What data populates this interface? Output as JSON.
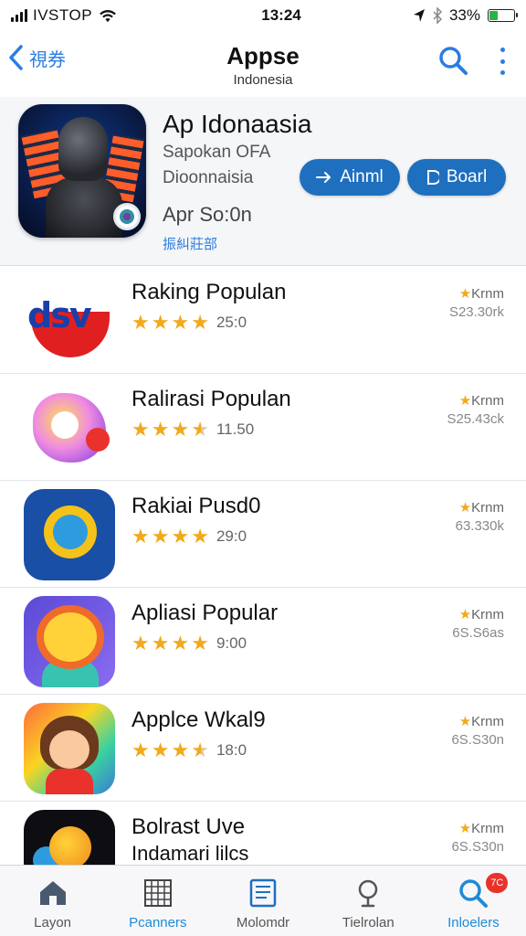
{
  "status_bar": {
    "carrier": "IVSTOP",
    "time": "13:24",
    "battery": "33%",
    "battery_level": 0.33
  },
  "nav": {
    "back_label": "視券",
    "title": "Appse",
    "subtitle": "Indonesia"
  },
  "featured": {
    "title": "Ap Idonaasia",
    "line1": "Sapokan OFA",
    "line2": "Dioonnaisia",
    "line3": "Apr So:0n",
    "line4": "振糾莊部",
    "install_label": "Ainml",
    "board_label": "Boarl"
  },
  "apps": [
    {
      "name": "Raking Populan",
      "name2": "",
      "rating": 4,
      "rating_text": "25:0",
      "meta_label": "Krnm",
      "meta_value": "S23.30rk"
    },
    {
      "name": "Ralirasi Populan",
      "name2": "",
      "rating": 3.5,
      "rating_text": "11.50",
      "meta_label": "Krnm",
      "meta_value": "S25.43ck"
    },
    {
      "name": "Rakiai Pusd0",
      "name2": "",
      "rating": 4,
      "rating_text": "29:0",
      "meta_label": "Krnm",
      "meta_value": "63.330k"
    },
    {
      "name": "Apliasi Popular",
      "name2": "",
      "rating": 4,
      "rating_text": "9:00",
      "meta_label": "Krnm",
      "meta_value": "6S.S6as"
    },
    {
      "name": "Applce Wkal9",
      "name2": "",
      "rating": 3.5,
      "rating_text": "18:0",
      "meta_label": "Krnm",
      "meta_value": "6S.S30n"
    },
    {
      "name": "Bolrast Uve",
      "name2": "Indamari lilcs",
      "rating": null,
      "rating_text": "",
      "meta_label": "Krnm",
      "meta_value": "6S.S30n"
    }
  ],
  "tabs": [
    {
      "label": "Layon",
      "icon": "home-icon"
    },
    {
      "label": "Pcanners",
      "icon": "grid-icon"
    },
    {
      "label": "Molomdr",
      "icon": "document-icon"
    },
    {
      "label": "Tielrolan",
      "icon": "location-icon"
    },
    {
      "label": "Inloelers",
      "icon": "search-icon",
      "badge": "7C"
    }
  ],
  "colors": {
    "accent": "#2a7de1",
    "button": "#1f6fbf",
    "star": "#f2a91a",
    "badge": "#e8322b"
  }
}
